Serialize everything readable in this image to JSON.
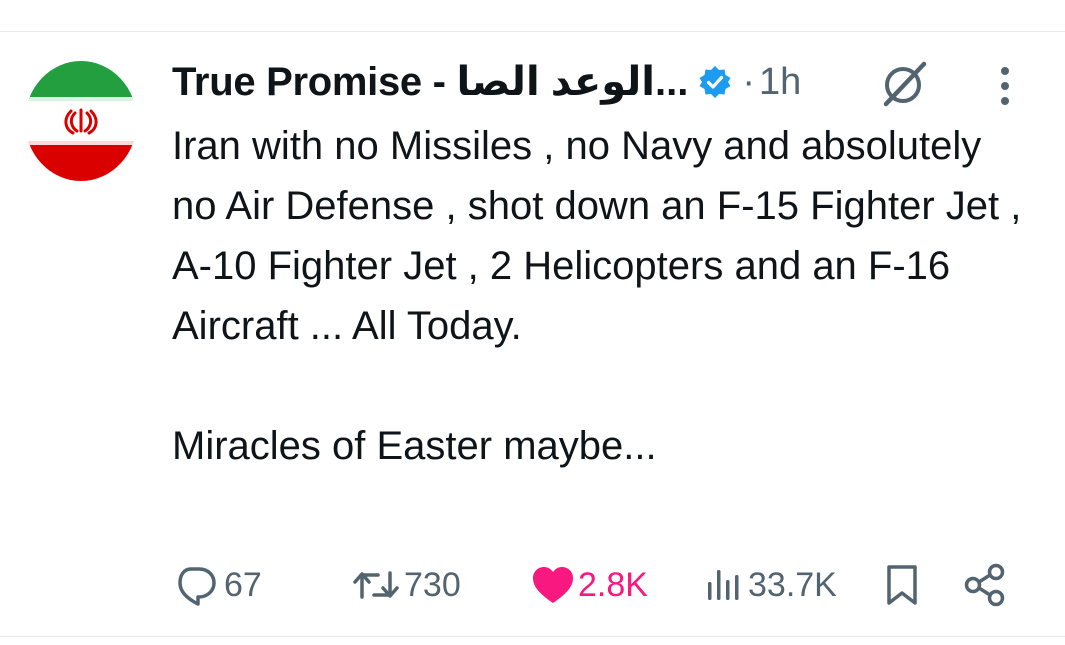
{
  "tweet": {
    "display_name": "True Promise - الوعد الصا...",
    "separator": "·",
    "time": "1h",
    "paragraphs": [
      "Iran with no Missiles , no Navy and absolutely no Air Defense , shot down an F-15 Fighter Jet , A-10 Fighter Jet , 2 Helicopters and an F-16 Aircraft ... All Today.",
      "Miracles of Easter maybe..."
    ]
  },
  "stats": {
    "replies": "67",
    "reposts": "730",
    "likes": "2.8K",
    "views": "33.7K"
  },
  "icons": {
    "avatar": "iran-flag-avatar",
    "verified": "verified-badge-icon",
    "grok": "grok-icon",
    "more": "more-vertical-icon",
    "reply": "reply-icon",
    "repost": "repost-icon",
    "like": "heart-icon",
    "views": "views-icon",
    "bookmark": "bookmark-icon",
    "share": "share-icon"
  },
  "colors": {
    "text": "#0f1419",
    "secondary": "#536471",
    "like": "#f91880",
    "verified": "#1d9bf0",
    "flag_green": "#239f40",
    "flag_red": "#da0000"
  }
}
